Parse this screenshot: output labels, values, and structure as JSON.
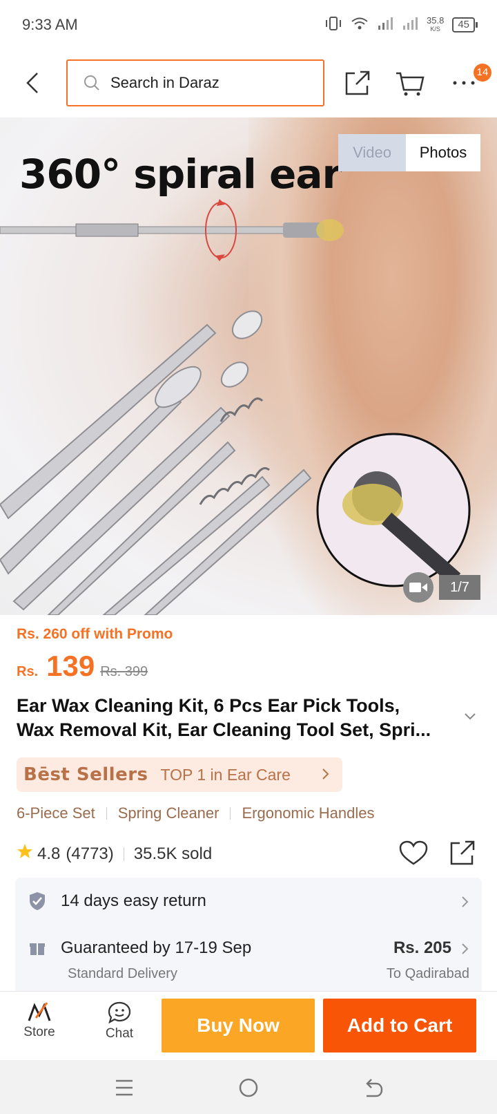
{
  "status_bar": {
    "time": "9:33 AM",
    "net_speed_value": "35.8",
    "net_speed_unit": "K/S",
    "battery": "45"
  },
  "header": {
    "search_placeholder": "Search in Daraz",
    "cart_badge": "14"
  },
  "gallery": {
    "image_caption": "360° spiral ear",
    "tab_video": "Video",
    "tab_photos": "Photos",
    "counter": "1/7"
  },
  "product": {
    "promo": "Rs. 260 off with Promo",
    "currency": "Rs.",
    "price": "139",
    "original_price": "Rs. 399",
    "title_line1": "Ear Wax Cleaning Kit, 6 Pcs Ear Pick Tools,",
    "title_line2": "Wax Removal Kit, Ear Cleaning Tool Set, Spri...",
    "bestseller_logo": "Bēst Sellers",
    "bestseller_text": "TOP 1 in Ear Care",
    "tags": [
      "6-Piece Set",
      "Spring Cleaner",
      "Ergonomic Handles"
    ],
    "rating": "4.8",
    "rating_count": "(4773)",
    "sold": "35.5K sold"
  },
  "services": {
    "return_label": "14 days easy return",
    "delivery_label": "Guaranteed by 17-19 Sep",
    "delivery_sub": "Standard Delivery",
    "delivery_fee": "Rs. 205",
    "delivery_location": "To Qadirabad"
  },
  "action_bar": {
    "store_label": "Store",
    "chat_label": "Chat",
    "buy_now": "Buy Now",
    "add_to_cart": "Add to Cart"
  },
  "colors": {
    "accent": "#f57224",
    "buy_now": "#fca625",
    "add_to_cart": "#f85606",
    "bestseller_bg": "#fdeae0",
    "tag_text": "#9a6b4d"
  }
}
